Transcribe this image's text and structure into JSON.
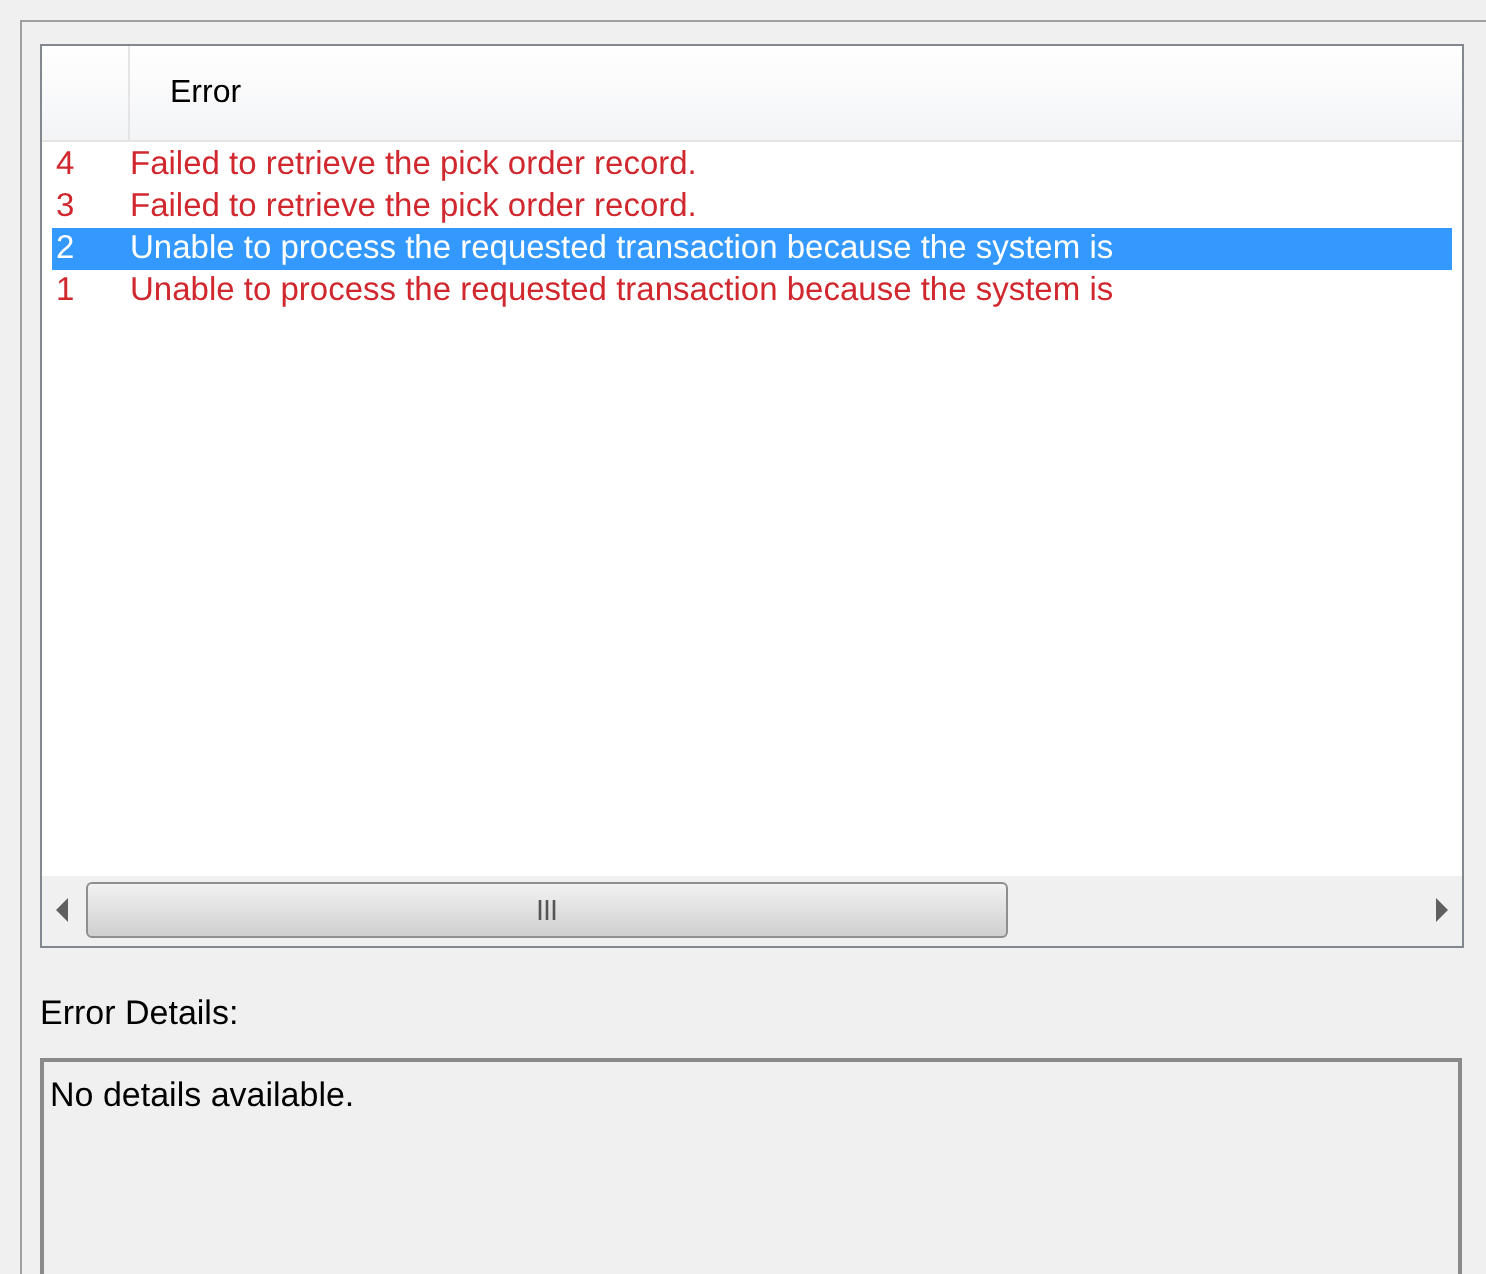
{
  "error_list": {
    "columns": [
      "Error"
    ],
    "rows": [
      {
        "number": "4",
        "message": "Failed to retrieve the pick order record.",
        "selected": false
      },
      {
        "number": "3",
        "message": "Failed to retrieve the pick order record.",
        "selected": false
      },
      {
        "number": "2",
        "message": "Unable to process the requested transaction because the system is",
        "selected": true
      },
      {
        "number": "1",
        "message": "Unable to process the requested transaction because the system is",
        "selected": false
      }
    ]
  },
  "details": {
    "label": "Error Details:",
    "value": "No details available."
  }
}
